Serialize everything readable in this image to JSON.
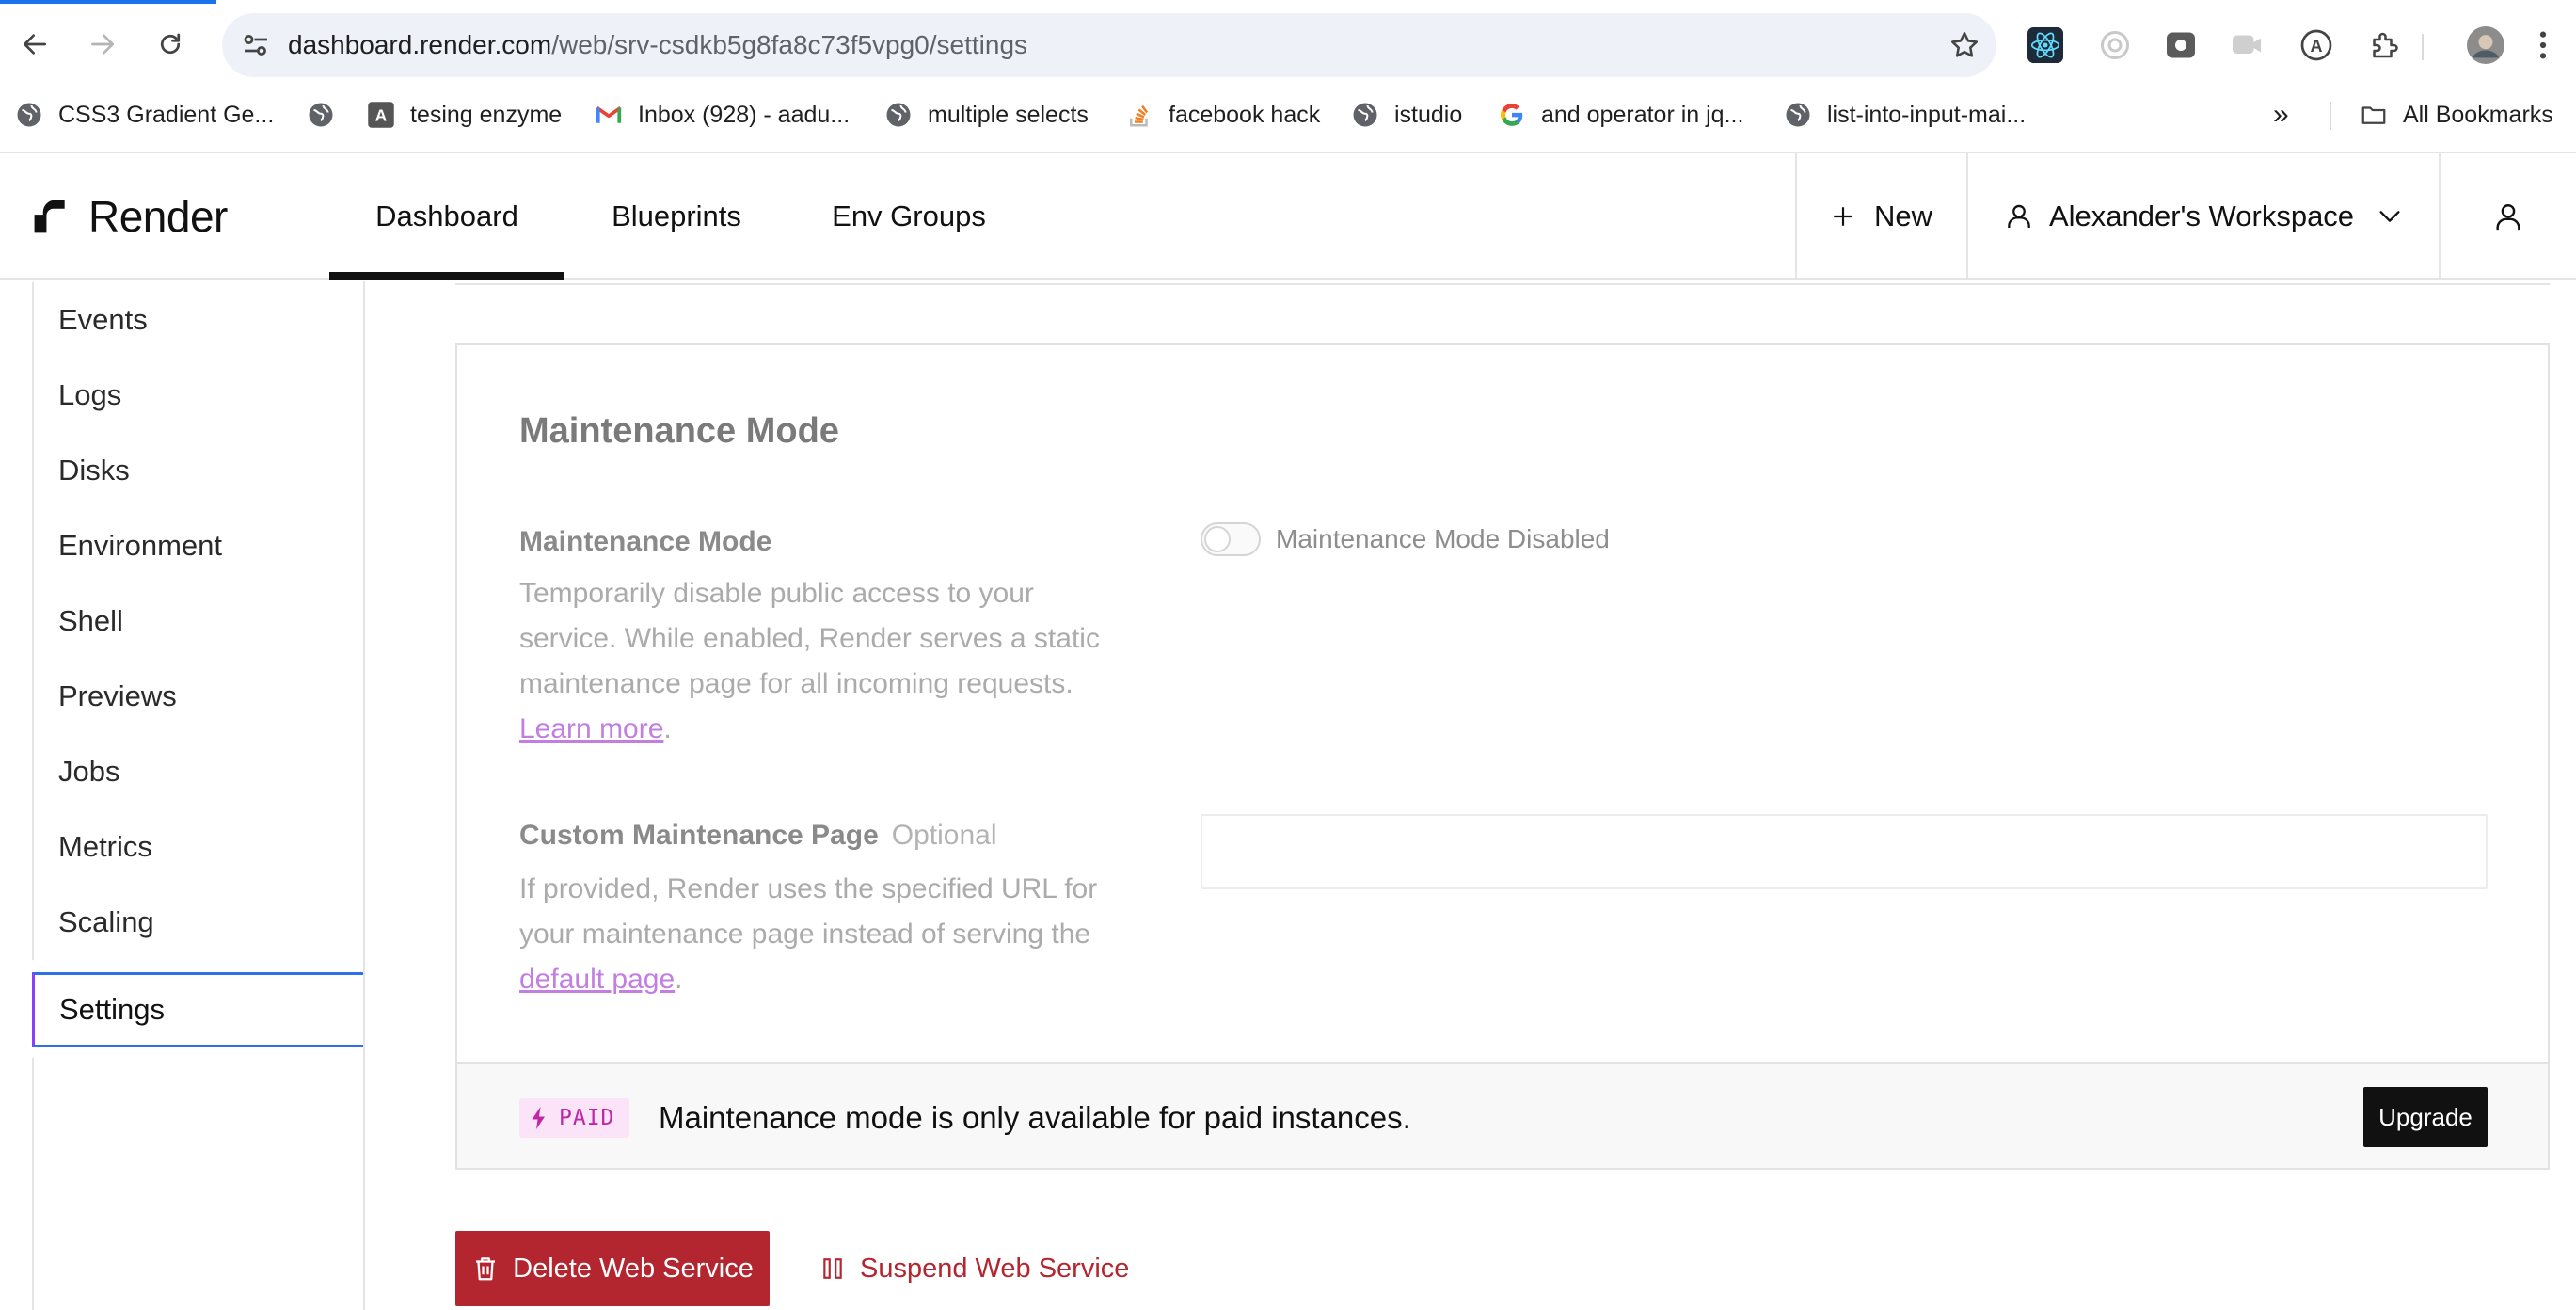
{
  "browser": {
    "url_host": "dashboard.render.com",
    "url_path": "/web/srv-csdkb5g8fa8c73f5vpg0/settings",
    "bookmarks": [
      {
        "label": "CSS3 Gradient Ge...",
        "icon": "globe-icon"
      },
      {
        "label": "",
        "icon": "globe-icon"
      },
      {
        "label": "tesing enzyme",
        "icon": "a-badge-icon"
      },
      {
        "label": "Inbox (928) - aadu...",
        "icon": "gmail-icon"
      },
      {
        "label": "multiple selects",
        "icon": "globe-icon"
      },
      {
        "label": "facebook hack",
        "icon": "stackoverflow-icon"
      },
      {
        "label": "istudio",
        "icon": "globe-icon"
      },
      {
        "label": "and operator in jq...",
        "icon": "google-icon"
      },
      {
        "label": "list-into-input-mai...",
        "icon": "globe-icon"
      }
    ],
    "overflow": "»",
    "all_bookmarks": "All Bookmarks"
  },
  "header": {
    "brand": "Render",
    "tabs": [
      "Dashboard",
      "Blueprints",
      "Env Groups"
    ],
    "active_tab": "Dashboard",
    "new_label": "New",
    "workspace_label": "Alexander's Workspace"
  },
  "sidebar": {
    "items": [
      "Events",
      "Logs",
      "Disks",
      "Environment",
      "Shell",
      "Previews",
      "Jobs",
      "Metrics",
      "Scaling",
      "Settings"
    ],
    "active": "Settings"
  },
  "maintenance": {
    "title": "Maintenance Mode",
    "mode_label": "Maintenance Mode",
    "mode_desc": "Temporarily disable public access to your service. While enabled, Render serves a static maintenance page for all incoming requests.",
    "learn_more": "Learn more",
    "toggle_label": "Maintenance Mode Disabled",
    "toggle_on": false,
    "custom_label": "Custom Maintenance Page",
    "optional_label": "Optional",
    "custom_desc": "If provided, Render uses the specified URL for your maintenance page instead of serving the",
    "default_page_link": "default page",
    "custom_value": "",
    "paid_badge": "PAID",
    "paid_message": "Maintenance mode is only available for paid instances.",
    "upgrade_label": "Upgrade"
  },
  "actions": {
    "delete_label": "Delete Web Service",
    "suspend_label": "Suspend Web Service"
  },
  "colors": {
    "danger": "#b3262f",
    "accent_purple": "#8a3ffc",
    "paid_badge": "#c026a8",
    "link": "#c27ee0"
  }
}
